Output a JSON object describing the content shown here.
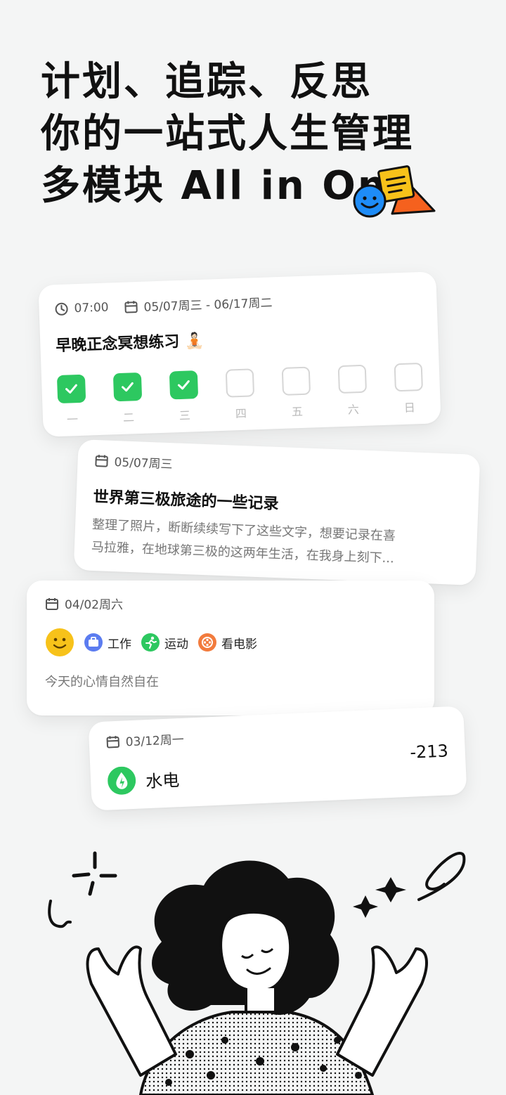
{
  "headline": {
    "line1": "计划、追踪、反思",
    "line2": "你的一站式人生管理",
    "line3": "多模块 All in One"
  },
  "habit_card": {
    "time": "07:00",
    "date_range": "05/07周三 - 06/17周二",
    "title": "早晚正念冥想练习 🧘🏻",
    "days": [
      {
        "label": "一",
        "done": true
      },
      {
        "label": "二",
        "done": true
      },
      {
        "label": "三",
        "done": true
      },
      {
        "label": "四",
        "done": false
      },
      {
        "label": "五",
        "done": false
      },
      {
        "label": "六",
        "done": false
      },
      {
        "label": "日",
        "done": false
      }
    ]
  },
  "journal_card": {
    "date": "05/07周三",
    "title": "世界第三极旅途的一些记录",
    "excerpt_line1": "整理了照片，断断续续写下了这些文字，想要记录在喜",
    "excerpt_line2": "马拉雅，在地球第三极的这两年生活，在我身上刻下..."
  },
  "mood_card": {
    "date": "04/02周六",
    "tags": [
      {
        "label": "工作",
        "icon": "briefcase-icon",
        "color": "#5b7cf0"
      },
      {
        "label": "运动",
        "icon": "running-icon",
        "color": "#2dc860"
      },
      {
        "label": "看电影",
        "icon": "film-reel-icon",
        "color": "#f27b3d"
      }
    ],
    "note": "今天的心情自然自在"
  },
  "expense_card": {
    "date": "03/12周一",
    "category": "水电",
    "amount": "-213",
    "icon_color": "#2dc860"
  },
  "colors": {
    "check_green": "#2dc860",
    "mood_yellow": "#f7c21a",
    "accent_blue": "#1e8cf7",
    "accent_orange": "#f5611e"
  }
}
